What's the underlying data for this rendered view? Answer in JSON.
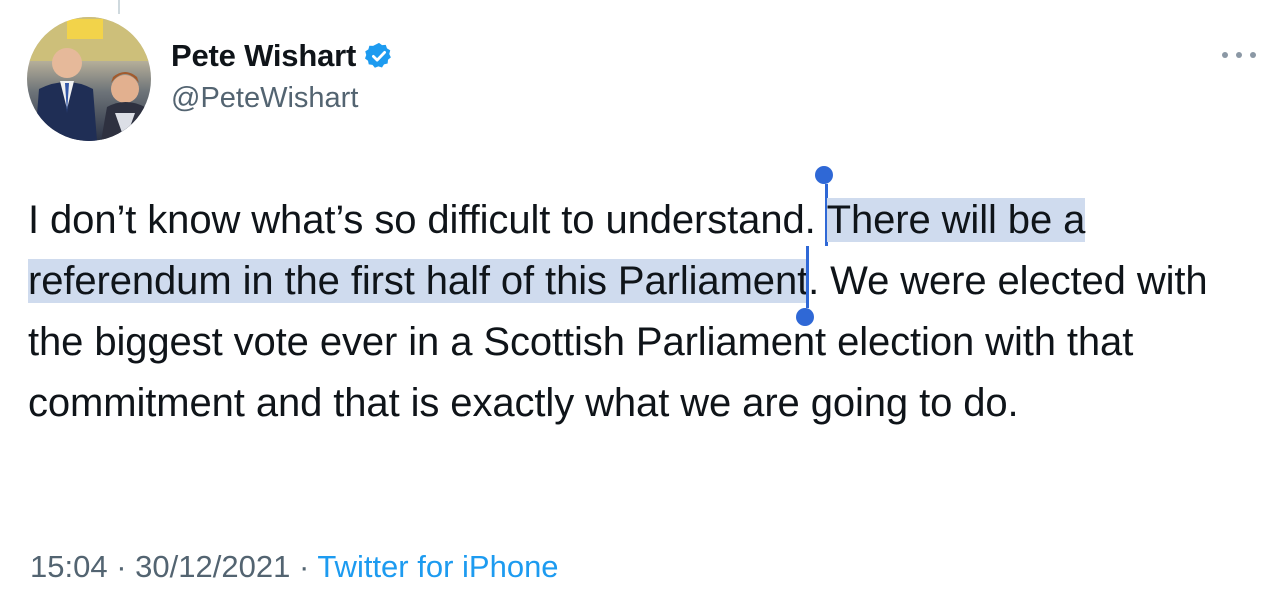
{
  "tweet": {
    "author": {
      "display_name": "Pete Wishart",
      "handle": "@PeteWishart",
      "verified": true,
      "avatar_icon": "profile-photo-avatar"
    },
    "more_icon": "ellipsis-icon",
    "text_before_selection": "I don’t know what’s so difficult to understand. ",
    "text_selected": "There will be a referendum in the first half of this Parliament",
    "text_after_selection": ". We were elected with the biggest vote ever in a Scottish Parliament election with that commitment and that is exactly what we are going to do.",
    "time": "15:04",
    "date": "30/12/2021",
    "separator": "·",
    "source": "Twitter for iPhone"
  },
  "colors": {
    "text": "#0f1419",
    "secondary": "#536471",
    "link": "#1d9bf0",
    "selection": "#cfdbee",
    "selection_handle": "#2f68d6",
    "verified": "#1d9bf0"
  }
}
